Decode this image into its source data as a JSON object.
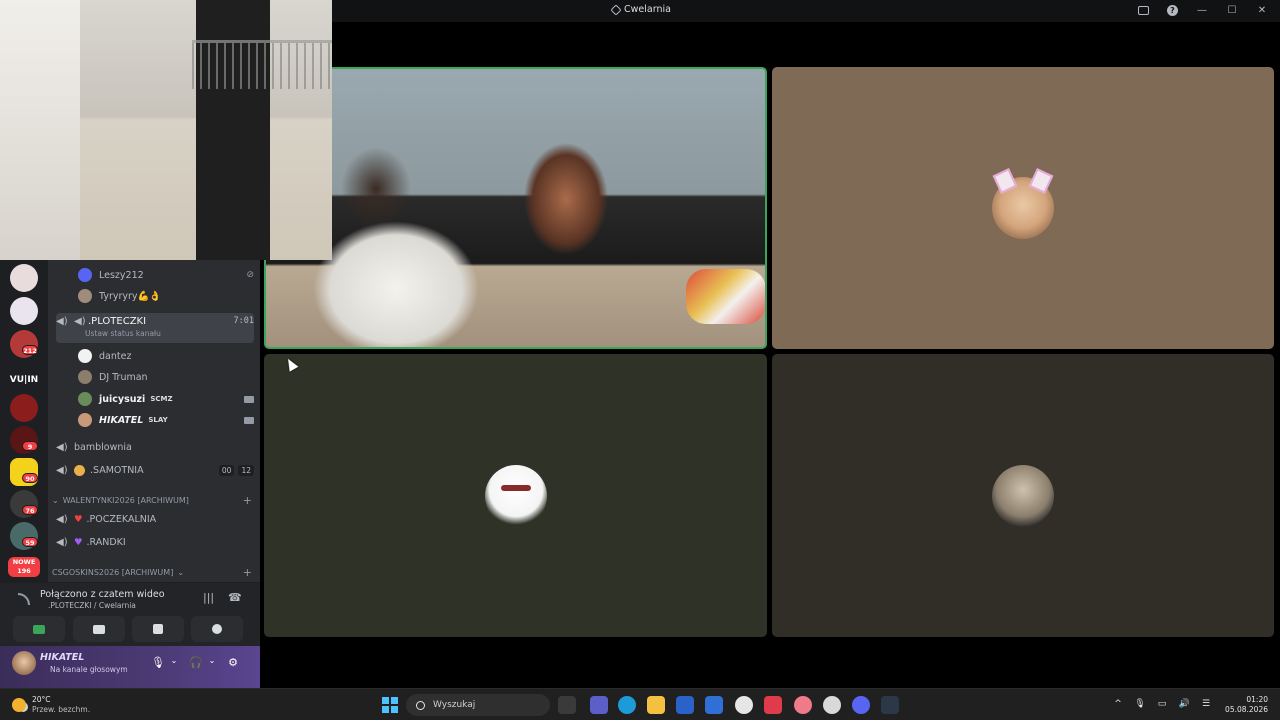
{
  "window": {
    "title": "Cwelarnia",
    "controls": [
      "inbox-icon",
      "help-icon",
      "minimize-icon",
      "maximize-icon",
      "close-icon"
    ]
  },
  "stage": {
    "tiles": [
      {
        "name": "camera-stream",
        "live": true
      },
      {
        "name": "participant-girl-avatar"
      },
      {
        "name": "participant-ghost-avatar"
      },
      {
        "name": "participant-cat-avatar"
      }
    ]
  },
  "sidebar": {
    "servers": [
      {
        "badge": ""
      },
      {
        "badge": ""
      },
      {
        "badge": "212"
      },
      {
        "label": "VU|IN"
      },
      {
        "badge": ""
      },
      {
        "badge": "9"
      },
      {
        "badge": "90"
      },
      {
        "badge": "76"
      },
      {
        "badge": "59"
      }
    ],
    "new_label_top": "NOWE",
    "new_label_bottom": "196",
    "channels": {
      "member_leszy": "Leszy212",
      "member_tyr": "Tyryryry💪👌",
      "voice_active": {
        "name": ".PLOTECZKI",
        "timer": "7:01",
        "status": "Ustaw status kanału"
      },
      "member_dantez": "dantez",
      "member_dj": "DJ Truman",
      "member_juicy": "juicysuzi",
      "member_juicy_tag": "SCMZ",
      "member_hikatel": "HIKATEL",
      "member_hikatel_tag": "SLAY",
      "bamblownia": "bamblownia",
      "samotnia": ".SAMOTNIA",
      "samotnia_counts": [
        "00",
        "12"
      ],
      "category1": "WALENTYNKI2026 [ARCHIWUM]",
      "poczekalnia": ".POCZEKALNIA",
      "randki": ".RANDKI",
      "category2": "CSGOSKINS2026 [ARCHIWUM]"
    },
    "voice_panel": {
      "title": "Połączono z czatem wideo",
      "subtitle": ".PLOTECZKI / Cwelarnia"
    },
    "user_panel": {
      "name": "HIKATEL",
      "status": "Na kanale głosowym"
    }
  },
  "taskbar": {
    "weather_temp": "20°C",
    "weather_desc": "Przew. bezchm.",
    "search_placeholder": "Wyszukaj",
    "time": "01:20",
    "date": "05.08.2026"
  },
  "colors": {
    "live_border": "#3ba55c",
    "sidebar_bg": "#2b2d31",
    "server_bg": "#1e1f22",
    "badge": "#f23f43",
    "userpanel": "#4b3a74"
  }
}
